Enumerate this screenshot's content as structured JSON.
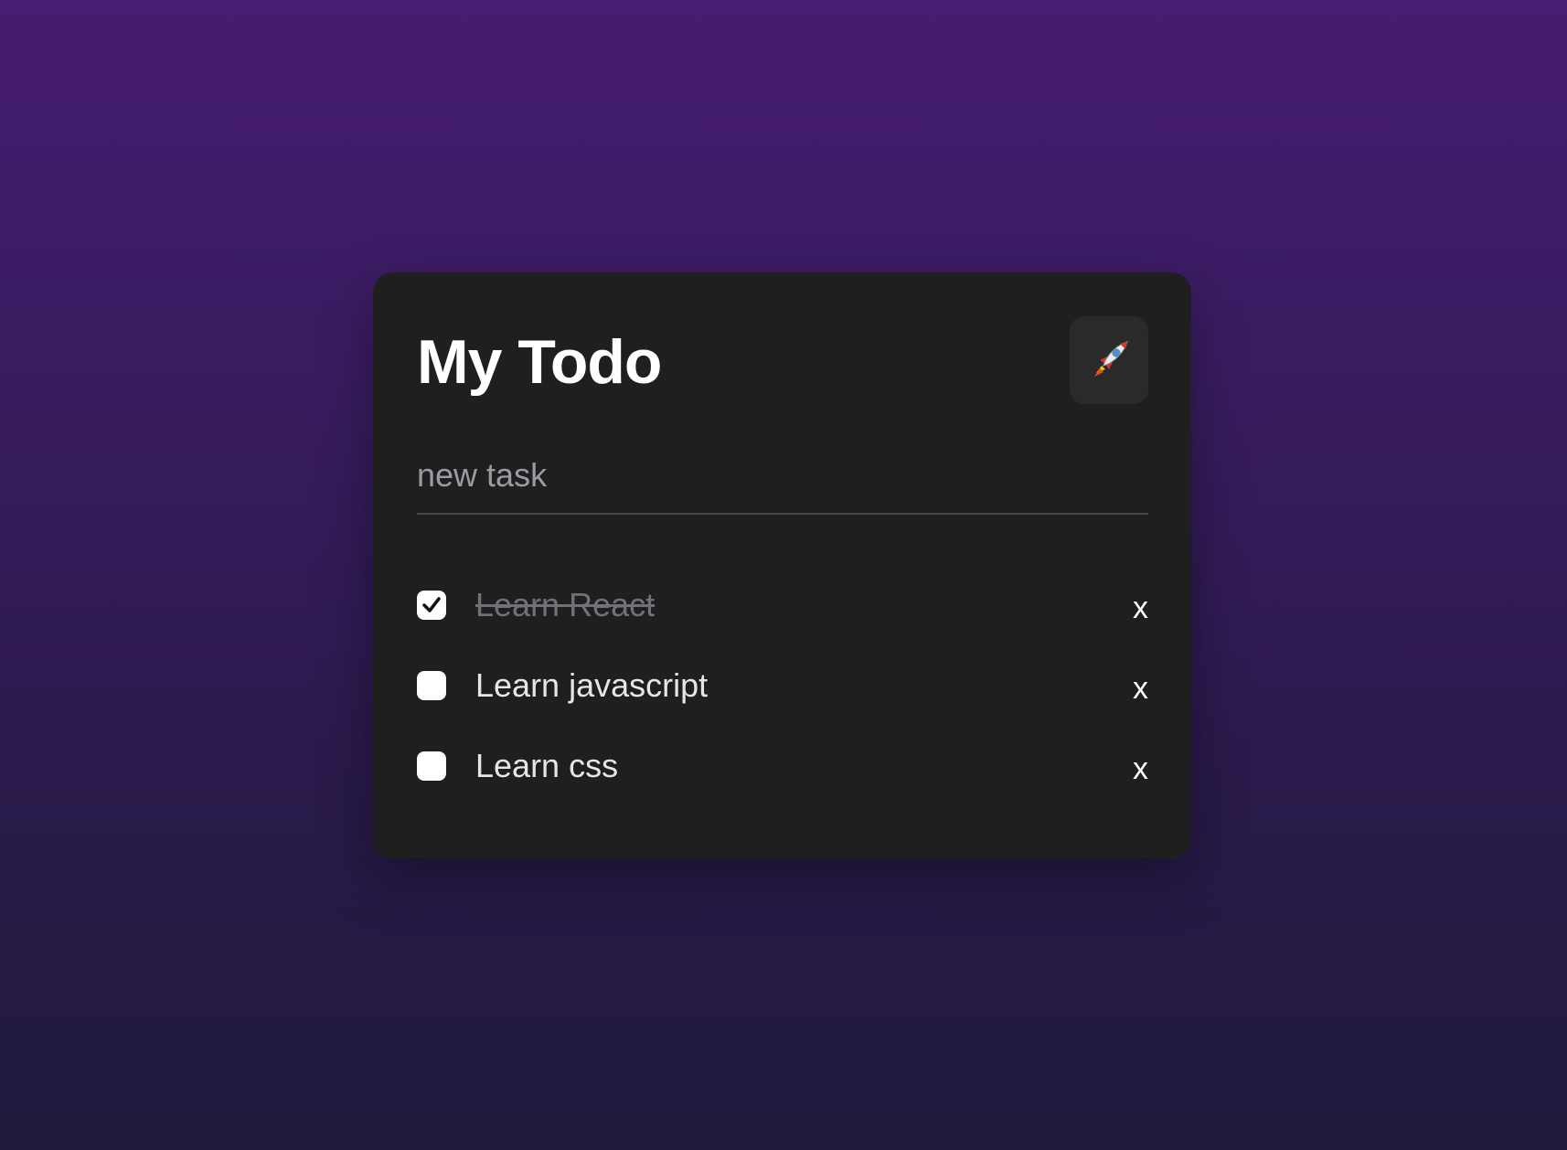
{
  "app": {
    "title": "My Todo",
    "theme_icon": "rocket-icon"
  },
  "input": {
    "placeholder": "new task",
    "value": ""
  },
  "todos": [
    {
      "label": "Learn React",
      "done": true,
      "delete_label": "x"
    },
    {
      "label": "Learn javascript",
      "done": false,
      "delete_label": "x"
    },
    {
      "label": "Learn css",
      "done": false,
      "delete_label": "x"
    }
  ],
  "colors": {
    "card_background": "#1f1f1f",
    "page_background_top": "#461d70",
    "page_background_bottom": "#201a3c",
    "done_text": "#6f7278"
  }
}
